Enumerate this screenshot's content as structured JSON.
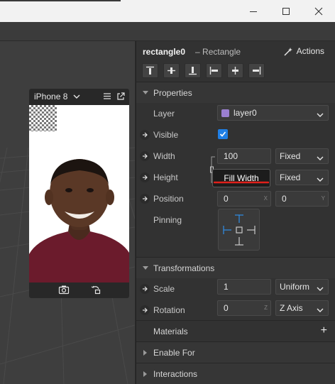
{
  "window": {
    "controls": [
      "minimize-icon",
      "maximize-icon",
      "close-icon"
    ]
  },
  "viewport": {
    "device": {
      "name": "iPhone 8",
      "icons": [
        "chevron-down-icon",
        "hamburger-menu-icon",
        "popout-icon",
        "camera-icon",
        "rotate-icon"
      ]
    }
  },
  "inspector": {
    "object_name": "rectangle0",
    "object_type": "– Rectangle",
    "actions_label": "Actions",
    "align_buttons": [
      "align-top",
      "align-middle",
      "align-bottom",
      "align-left",
      "align-center",
      "align-right"
    ],
    "properties_label": "Properties",
    "layer": {
      "label": "Layer",
      "value": "layer0",
      "color": "#9a7fd0"
    },
    "visible": {
      "label": "Visible",
      "checked": true
    },
    "width": {
      "label": "Width",
      "value": "100",
      "mode": "Fixed"
    },
    "height": {
      "label": "Height",
      "mode": "Fixed"
    },
    "tooltip": "Fill Width",
    "position": {
      "label": "Position",
      "x": "0",
      "x_unit": "X",
      "y": "0",
      "y_unit": "Y"
    },
    "pinning_label": "Pinning",
    "transformations_label": "Transformations",
    "scale": {
      "label": "Scale",
      "value": "1",
      "mode": "Uniform"
    },
    "rotation": {
      "label": "Rotation",
      "value": "0",
      "unit": "Z",
      "axis": "Z Axis"
    },
    "materials_label": "Materials",
    "materials_add": "+",
    "enable_for_label": "Enable For",
    "interactions_label": "Interactions"
  },
  "colors": {
    "accent": "#1f7fe5",
    "pin_blue": "#2f8fe8",
    "underline_red": "#e0201a"
  }
}
